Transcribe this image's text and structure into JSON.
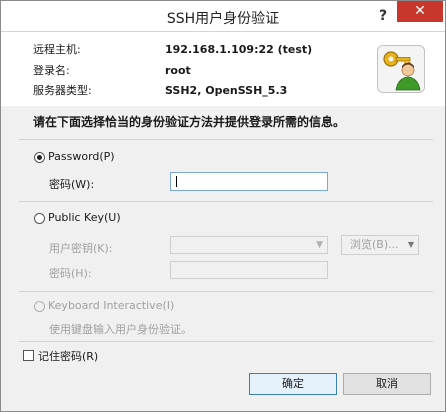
{
  "title": "SSH用户身份验证",
  "titlebar": {
    "help_glyph": "?",
    "close_glyph": "✕"
  },
  "info": {
    "rows": [
      {
        "label": "远程主机:",
        "value": "192.168.1.109:22 (test)"
      },
      {
        "label": "登录名:",
        "value": "root"
      },
      {
        "label": "服务器类型:",
        "value": "SSH2, OpenSSH_5.3"
      }
    ]
  },
  "prompt": "请在下面选择恰当的身份验证方法并提供登录所需的信息。",
  "password": {
    "option_label": "Password(P)",
    "selected": true,
    "field_label": "密码(W):",
    "value": ""
  },
  "public_key": {
    "option_label": "Public Key(U)",
    "selected": false,
    "user_key_label": "用户密钥(K):",
    "user_key_value": "",
    "browse_label": "浏览(B)...",
    "passphrase_label": "密码(H):",
    "passphrase_value": ""
  },
  "keyboard_interactive": {
    "option_label": "Keyboard Interactive(I)",
    "selected": false,
    "enabled": false,
    "description": "使用键盘输入用户身份验证。"
  },
  "remember": {
    "label": "记住密码(R)",
    "checked": false
  },
  "buttons": {
    "ok": "确定",
    "cancel": "取消"
  },
  "colors": {
    "close": "#c7372b",
    "focus": "#7aa7d8",
    "default_button": "#3c7fb1"
  }
}
